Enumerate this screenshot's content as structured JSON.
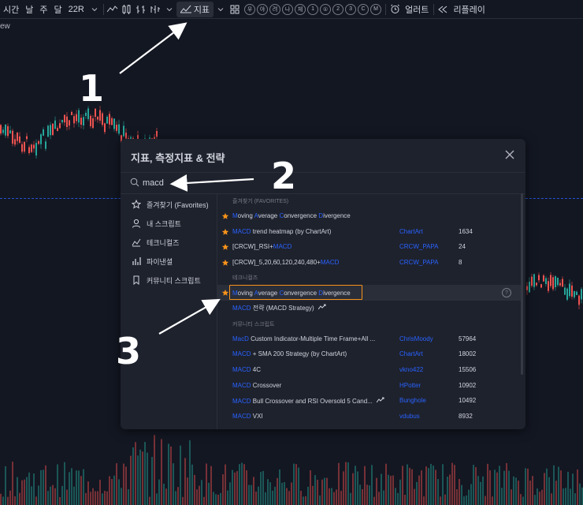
{
  "toolbar": {
    "time": "시간",
    "day": "날",
    "week": "주",
    "month": "달",
    "range": "22R",
    "indicators": "지표",
    "alert": "얼러트",
    "replay": "리플레이",
    "circles": [
      "우",
      "야",
      "려",
      "나",
      "체",
      "1",
      "①",
      "2",
      "3",
      "C",
      "M"
    ]
  },
  "chart_label": "ew",
  "annotations": {
    "n1": "1",
    "n2": "2",
    "n3": "3"
  },
  "modal": {
    "title": "지표, 측정지표 & 전략",
    "search_value": "macd",
    "side": [
      {
        "icon": "star-icon",
        "label": "즐겨찾기 (Favorites)"
      },
      {
        "icon": "user-icon",
        "label": "내 스크립트"
      },
      {
        "icon": "technical-icon",
        "label": "테크니컬즈"
      },
      {
        "icon": "financial-icon",
        "label": "파이낸셜"
      },
      {
        "icon": "bookmark-icon",
        "label": "커뮤니티 스크립트"
      }
    ],
    "sections": {
      "favorites": "즐겨찾기 (FAVORITES)",
      "technicals": "테크니컬즈",
      "community": "커뮤니티 스크립트"
    },
    "favorites": [
      {
        "name": "Moving Average Convergence Divergence",
        "author": "",
        "count": ""
      },
      {
        "name_pre": "",
        "name_hl": "MACD",
        "name_post": " trend heatmap (by ChartArt)",
        "author": "ChartArt",
        "count": "1634"
      },
      {
        "name_pre": "[CRCW]_RSI+",
        "name_hl": "MACD",
        "name_post": "",
        "author": "CRCW_PAPA",
        "count": "24"
      },
      {
        "name_pre": "[CRCW]_5,20,60,120,240,480+",
        "name_hl": "MACD",
        "name_post": "",
        "author": "CRCW_PAPA",
        "count": "8"
      }
    ],
    "technicals": [
      {
        "name": "Moving Average Convergence Divergence",
        "help": "?"
      },
      {
        "name_hl": "MACD",
        "name_post": " 전략 (MACD Strategy)"
      }
    ],
    "community": [
      {
        "name_hl": "MacD",
        "name_post": " Custom Indicator-Multiple Time Frame+All ...",
        "author": "ChrisMoody",
        "count": "57964"
      },
      {
        "name_hl": "MACD",
        "name_post": " + SMA 200 Strategy (by ChartArt)",
        "author": "ChartArt",
        "count": "18002"
      },
      {
        "name_hl": "MACD",
        "name_post": " 4C",
        "author": "vkno422",
        "count": "15506"
      },
      {
        "name_hl": "MACD",
        "name_post": " Crossover",
        "author": "HPotter",
        "count": "10902"
      },
      {
        "name_hl": "MACD",
        "name_post": " Bull Crossover and RSI Oversold 5 Cand...",
        "author": "Bunghole",
        "count": "10492"
      },
      {
        "name_hl": "MACD",
        "name_post": " VXI",
        "author": "vdubus",
        "count": "8932"
      }
    ]
  },
  "colors": {
    "accent": "#2962ff",
    "star": "#f7931a",
    "up": "#26a69a",
    "down": "#ef5350"
  }
}
